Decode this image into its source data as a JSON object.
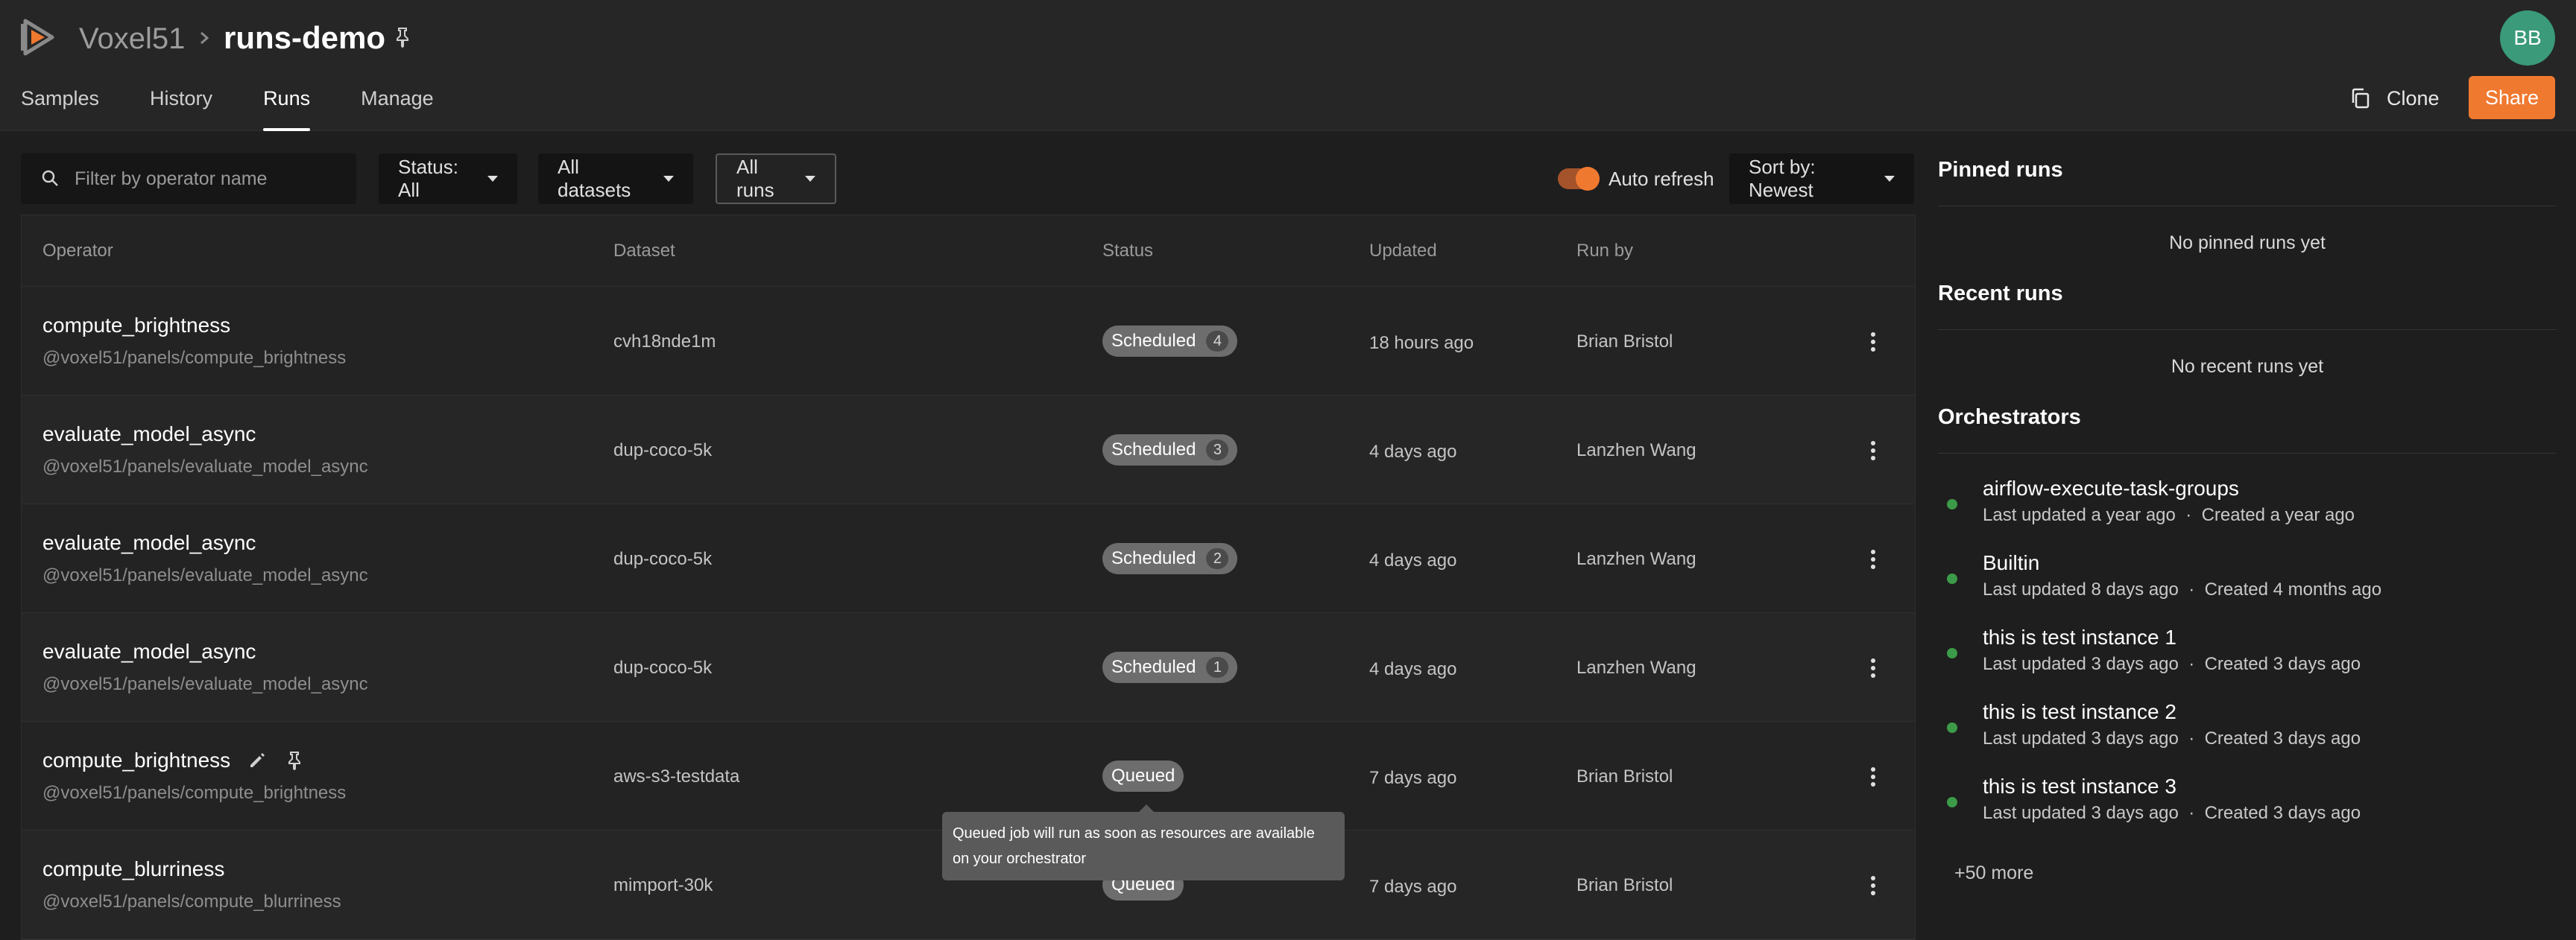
{
  "header": {
    "brand": "Voxel51",
    "dataset": "runs-demo",
    "avatar_initials": "BB",
    "clone_label": "Clone",
    "share_label": "Share"
  },
  "tabs": [
    {
      "label": "Samples",
      "active": false
    },
    {
      "label": "History",
      "active": false
    },
    {
      "label": "Runs",
      "active": true
    },
    {
      "label": "Manage",
      "active": false
    }
  ],
  "filters": {
    "search_placeholder": "Filter by operator name",
    "status": "Status: All",
    "datasets": "All datasets",
    "runs": "All runs",
    "auto_refresh_label": "Auto refresh",
    "auto_refresh_on": true,
    "sort": "Sort by: Newest"
  },
  "table": {
    "columns": [
      "Operator",
      "Dataset",
      "Status",
      "Updated",
      "Run by"
    ],
    "rows": [
      {
        "operator": "compute_brightness",
        "uri": "@voxel51/panels/compute_brightness",
        "dataset": "cvh18nde1m",
        "status": "Scheduled",
        "count": "4",
        "updated": "18 hours ago",
        "run_by": "Brian Bristol"
      },
      {
        "operator": "evaluate_model_async",
        "uri": "@voxel51/panels/evaluate_model_async",
        "dataset": "dup-coco-5k",
        "status": "Scheduled",
        "count": "3",
        "updated": "4 days ago",
        "run_by": "Lanzhen Wang"
      },
      {
        "operator": "evaluate_model_async",
        "uri": "@voxel51/panels/evaluate_model_async",
        "dataset": "dup-coco-5k",
        "status": "Scheduled",
        "count": "2",
        "updated": "4 days ago",
        "run_by": "Lanzhen Wang"
      },
      {
        "operator": "evaluate_model_async",
        "uri": "@voxel51/panels/evaluate_model_async",
        "dataset": "dup-coco-5k",
        "status": "Scheduled",
        "count": "1",
        "updated": "4 days ago",
        "run_by": "Lanzhen Wang"
      },
      {
        "operator": "compute_brightness",
        "uri": "@voxel51/panels/compute_brightness",
        "dataset": "aws-s3-testdata",
        "status": "Queued",
        "count": "",
        "updated": "7 days ago",
        "run_by": "Brian Bristol"
      },
      {
        "operator": "compute_blurriness",
        "uri": "@voxel51/panels/compute_blurriness",
        "dataset": "mimport-30k",
        "status": "Queued",
        "count": "",
        "updated": "7 days ago",
        "run_by": "Brian Bristol"
      }
    ]
  },
  "tooltip": {
    "line1": "Queued job will run as soon as resources are available",
    "line2": "on your orchestrator"
  },
  "sidebar": {
    "pinned_title": "Pinned runs",
    "pinned_empty": "No pinned runs yet",
    "recent_title": "Recent runs",
    "recent_empty": "No recent runs yet",
    "orchestrators_title": "Orchestrators",
    "separator": "·",
    "orchestrators": [
      {
        "name": "airflow-execute-task-groups",
        "updated": "Last updated a year ago",
        "created": "Created a year ago"
      },
      {
        "name": "Builtin",
        "updated": "Last updated 8 days ago",
        "created": "Created 4 months ago"
      },
      {
        "name": "this is test instance 1",
        "updated": "Last updated 3 days ago",
        "created": "Created 3 days ago"
      },
      {
        "name": "this is test instance 2",
        "updated": "Last updated 3 days ago",
        "created": "Created 3 days ago"
      },
      {
        "name": "this is test instance 3",
        "updated": "Last updated 3 days ago",
        "created": "Created 3 days ago"
      }
    ],
    "more_label": "+50 more"
  },
  "colors": {
    "accent": "#f07930",
    "online": "#3c9b48",
    "avatar": "#3a9a7a"
  }
}
